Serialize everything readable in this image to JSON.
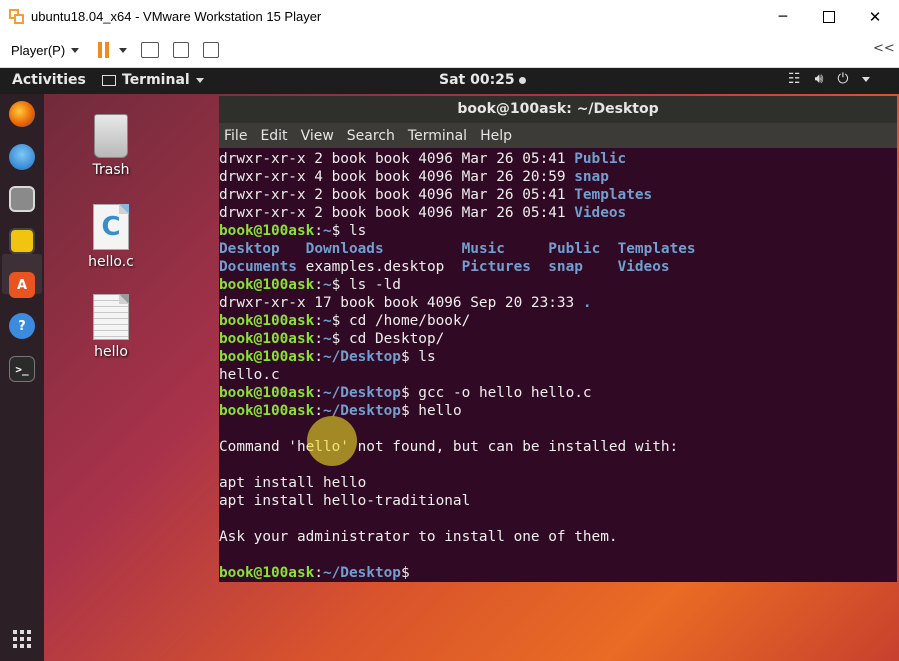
{
  "vmware": {
    "title": "ubuntu18.04_x64 - VMware Workstation 15 Player",
    "minimize": "─",
    "close": "✕",
    "player_menu": "Player(P)",
    "collapse": "<<"
  },
  "topbar": {
    "activities": "Activities",
    "app_menu": "Terminal",
    "clock": "Sat 00:25",
    "network_icon": "network-icon",
    "volume_icon": "volume-icon",
    "power_icon": "power-icon"
  },
  "dock": {
    "items": [
      "firefox-icon",
      "thunderbird-icon",
      "files-icon",
      "rhythmbox-icon",
      "software-icon",
      "help-icon",
      "terminal-icon"
    ]
  },
  "desktop": {
    "icons": [
      "Trash",
      "hello.c",
      "hello"
    ]
  },
  "terminal": {
    "title": "book@100ask: ~/Desktop",
    "menu": [
      "File",
      "Edit",
      "View",
      "Search",
      "Terminal",
      "Help"
    ],
    "user": "book@100ask",
    "prompt_home": "~",
    "prompt_desktop": "~/Desktop",
    "lines": {
      "l1_perm": "drwxr-xr-x 2 book book 4096 Mar 26 05:41 ",
      "l1_name": "Public",
      "l2_perm": "drwxr-xr-x 4 book book 4096 Mar 26 20:59 ",
      "l2_name": "snap",
      "l3_perm": "drwxr-xr-x 2 book book 4096 Mar 26 05:41 ",
      "l3_name": "Templates",
      "l4_perm": "drwxr-xr-x 2 book book 4096 Mar 26 05:41 ",
      "l4_name": "Videos",
      "cmd_ls": "ls",
      "ls_row1": [
        "Desktop",
        "Downloads",
        "Music",
        "Public",
        "Templates"
      ],
      "ls_row2_dir1": "Documents",
      "ls_row2_file": "examples.desktop",
      "ls_row2_dirs": [
        "Pictures",
        "snap",
        "Videos"
      ],
      "cmd_ls_ld": "ls -ld",
      "ld_out": "drwxr-xr-x 17 book book 4096 Sep 20 23:33 ",
      "ld_dot": ".",
      "cmd_cd_home": "cd /home/book/",
      "cmd_cd_desktop": "cd Desktop/",
      "cmd_ls2": "ls",
      "out_helloc": "hello.c",
      "cmd_gcc": "gcc -o hello hello.c",
      "cmd_hello": "hello",
      "err1": "Command 'hello' not found, but can be installed with:",
      "apt1": "apt install hello",
      "apt2": "apt install hello-traditional",
      "advice": "Ask your administrator to install one of them."
    }
  }
}
